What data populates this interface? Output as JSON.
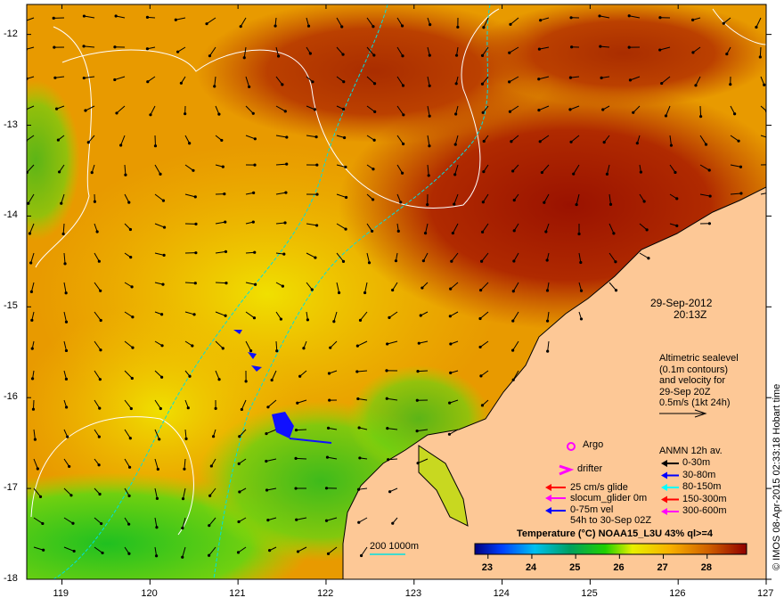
{
  "map": {
    "lon_ticks": [
      "119",
      "120",
      "121",
      "122",
      "123",
      "124",
      "125",
      "126",
      "127"
    ],
    "lat_ticks": [
      "-12",
      "-13",
      "-14",
      "-15",
      "-16",
      "-17",
      "-18"
    ],
    "lon_range": [
      118.6,
      127
    ],
    "lat_range": [
      -18,
      -11.67
    ]
  },
  "date": {
    "day": "29-Sep-2012",
    "time": "20:13Z"
  },
  "altimetry": {
    "lines": [
      "Altimetric sealevel",
      "(0.1m contours)",
      "and velocity for",
      "29-Sep 20Z",
      "0.5m/s (1kt 24h)"
    ]
  },
  "legend": {
    "argo": "Argo",
    "drifter": "drifter",
    "glide": "25 cm/s glide",
    "slocum": "slocum_glider 0m",
    "vel": "0-75m vel",
    "vel_period": "54h to 30-Sep 02Z",
    "anmn_title": "ANMN 12h av.",
    "anmn": [
      {
        "label": "0-30m",
        "color": "#000000"
      },
      {
        "label": "30-80m",
        "color": "#0000ff"
      },
      {
        "label": "80-150m",
        "color": "#00ffff"
      },
      {
        "label": "150-300m",
        "color": "#ff0000"
      },
      {
        "label": "300-600m",
        "color": "#ff00ff"
      }
    ],
    "isobath": "200  1000m"
  },
  "colorbar": {
    "title": "Temperature (°C) NOAA15_L3U 43% ql>=4",
    "ticks": [
      "23",
      "24",
      "25",
      "26",
      "27",
      "28"
    ],
    "range": [
      22.7,
      28.9
    ]
  },
  "credit": "© IMOS 08-Apr-2015 02:33:18 Hobart time",
  "colors": {
    "land": "#fdc896",
    "warm": "#a01800",
    "cyan": "#00e0e0"
  }
}
